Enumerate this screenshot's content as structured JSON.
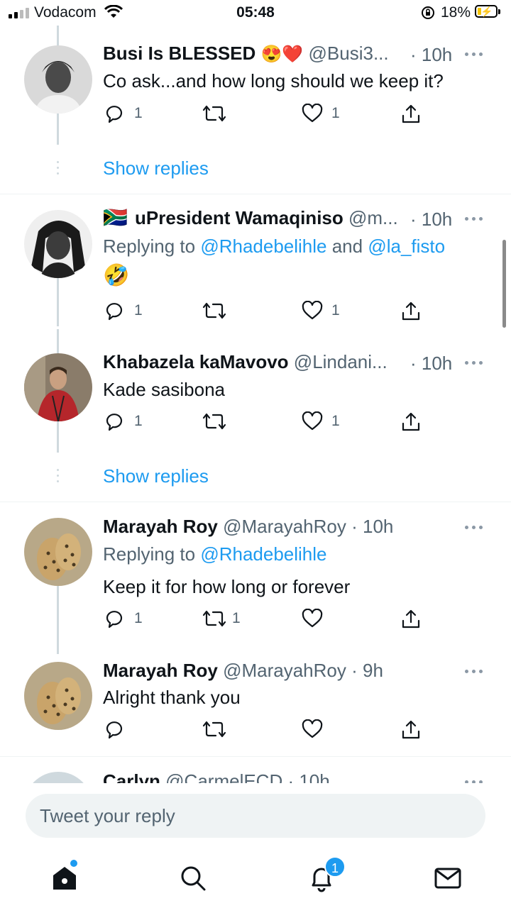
{
  "status_bar": {
    "carrier": "Vodacom",
    "time": "05:48",
    "battery_percent": "18%"
  },
  "tweets": [
    {
      "name": "Busi Is BLESSED",
      "name_emojis": "😍❤️",
      "handle": "@Busi3...",
      "time": "· 10h",
      "text": "Co ask...and how long should we keep it?",
      "replies": "1",
      "retweets": "",
      "likes": "1"
    },
    {
      "flag": "🇿🇦",
      "name": "uPresident Wamaqiniso",
      "handle": "@m...",
      "time": "· 10h",
      "replying_prefix": "Replying to ",
      "replying_users": [
        "@Rhadebelihle",
        "@la_fisto"
      ],
      "replying_joiner": " and ",
      "text": "🤣",
      "replies": "1",
      "retweets": "",
      "likes": "1"
    },
    {
      "name": "Khabazela kaMavovo",
      "handle": "@Lindani...",
      "time": "· 10h",
      "text": "Kade sasibona",
      "replies": "1",
      "retweets": "",
      "likes": "1"
    },
    {
      "name": "Marayah Roy",
      "handle": "@MarayahRoy",
      "time": "· 10h",
      "replying_prefix": "Replying to ",
      "replying_users": [
        "@Rhadebelihle"
      ],
      "text": "Keep it for how long or forever",
      "replies": "1",
      "retweets": "1",
      "likes": ""
    },
    {
      "name": "Marayah Roy",
      "handle": "@MarayahRoy",
      "time": "· 9h",
      "text": "Alright thank you",
      "replies": "",
      "retweets": "",
      "likes": ""
    },
    {
      "name": "Carlyn",
      "handle": "@CarmelECD",
      "time": "· 10h"
    }
  ],
  "show_replies_label": "Show replies",
  "composer": {
    "placeholder": "Tweet your reply"
  },
  "nav": {
    "notifications_badge": "1",
    "items": [
      "home-icon",
      "search-icon",
      "notifications-icon",
      "messages-icon"
    ]
  },
  "colors": {
    "accent": "#1d9bf0",
    "muted": "#536471",
    "text": "#0f1419"
  }
}
